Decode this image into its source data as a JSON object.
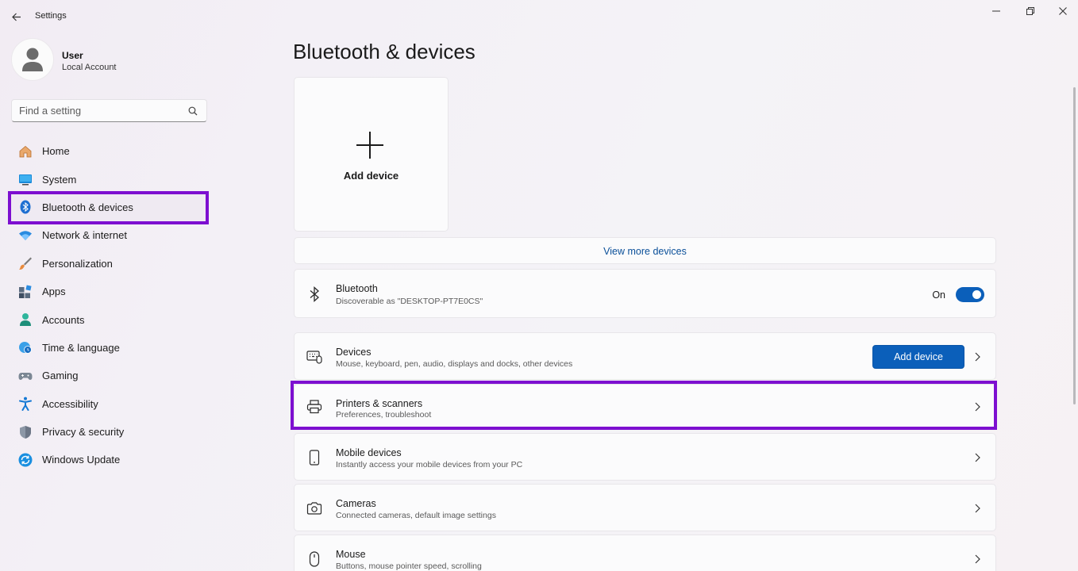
{
  "app": {
    "title": "Settings"
  },
  "user": {
    "name": "User",
    "account_type": "Local Account"
  },
  "search": {
    "placeholder": "Find a setting"
  },
  "sidebar": {
    "items": [
      {
        "label": "Home",
        "icon": "home-icon"
      },
      {
        "label": "System",
        "icon": "system-icon"
      },
      {
        "label": "Bluetooth & devices",
        "icon": "bluetooth-icon",
        "selected": true
      },
      {
        "label": "Network & internet",
        "icon": "wifi-icon"
      },
      {
        "label": "Personalization",
        "icon": "brush-icon"
      },
      {
        "label": "Apps",
        "icon": "apps-icon"
      },
      {
        "label": "Accounts",
        "icon": "account-icon"
      },
      {
        "label": "Time & language",
        "icon": "globe-clock-icon"
      },
      {
        "label": "Gaming",
        "icon": "gamepad-icon"
      },
      {
        "label": "Accessibility",
        "icon": "accessibility-icon"
      },
      {
        "label": "Privacy & security",
        "icon": "shield-icon"
      },
      {
        "label": "Windows Update",
        "icon": "update-icon"
      }
    ]
  },
  "main": {
    "title": "Bluetooth & devices",
    "add_tile_label": "Add device",
    "view_more_label": "View more devices",
    "bluetooth": {
      "title": "Bluetooth",
      "subtitle": "Discoverable as \"DESKTOP-PT7E0CS\"",
      "state_label": "On",
      "enabled": true
    },
    "devices": {
      "title": "Devices",
      "subtitle": "Mouse, keyboard, pen, audio, displays and docks, other devices",
      "button_label": "Add device"
    },
    "printers": {
      "title": "Printers & scanners",
      "subtitle": "Preferences, troubleshoot"
    },
    "mobile": {
      "title": "Mobile devices",
      "subtitle": "Instantly access your mobile devices from your PC"
    },
    "cameras": {
      "title": "Cameras",
      "subtitle": "Connected cameras, default image settings"
    },
    "mouse": {
      "title": "Mouse",
      "subtitle": "Buttons, mouse pointer speed, scrolling"
    }
  },
  "colors": {
    "accent": "#0b5fba",
    "highlight": "#7d0fd0"
  }
}
